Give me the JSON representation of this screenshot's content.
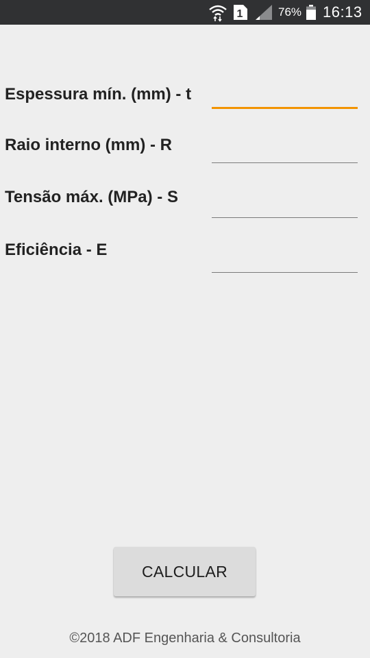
{
  "status_bar": {
    "battery_percent": "76%",
    "time": "16:13",
    "sim_label": "1",
    "icons": [
      "wifi-icon",
      "sim-icon",
      "signal-icon",
      "battery-icon"
    ],
    "battery_level": 0.76
  },
  "form": {
    "fields": [
      {
        "label": "Espessura mín. (mm) - t",
        "value": "",
        "focused": true
      },
      {
        "label": "Raio interno (mm) - R",
        "value": "",
        "focused": false
      },
      {
        "label": "Tensão máx. (MPa) - S",
        "value": "",
        "focused": false
      },
      {
        "label": "Eficiência - E",
        "value": "",
        "focused": false
      }
    ]
  },
  "actions": {
    "calculate_label": "CALCULAR"
  },
  "footer": {
    "copyright": "©2018 ADF Engenharia & Consultoria"
  },
  "colors": {
    "accent": "#f29300",
    "status_bar": "#303133",
    "background": "#eeeeee",
    "button": "#dcdcdc"
  }
}
